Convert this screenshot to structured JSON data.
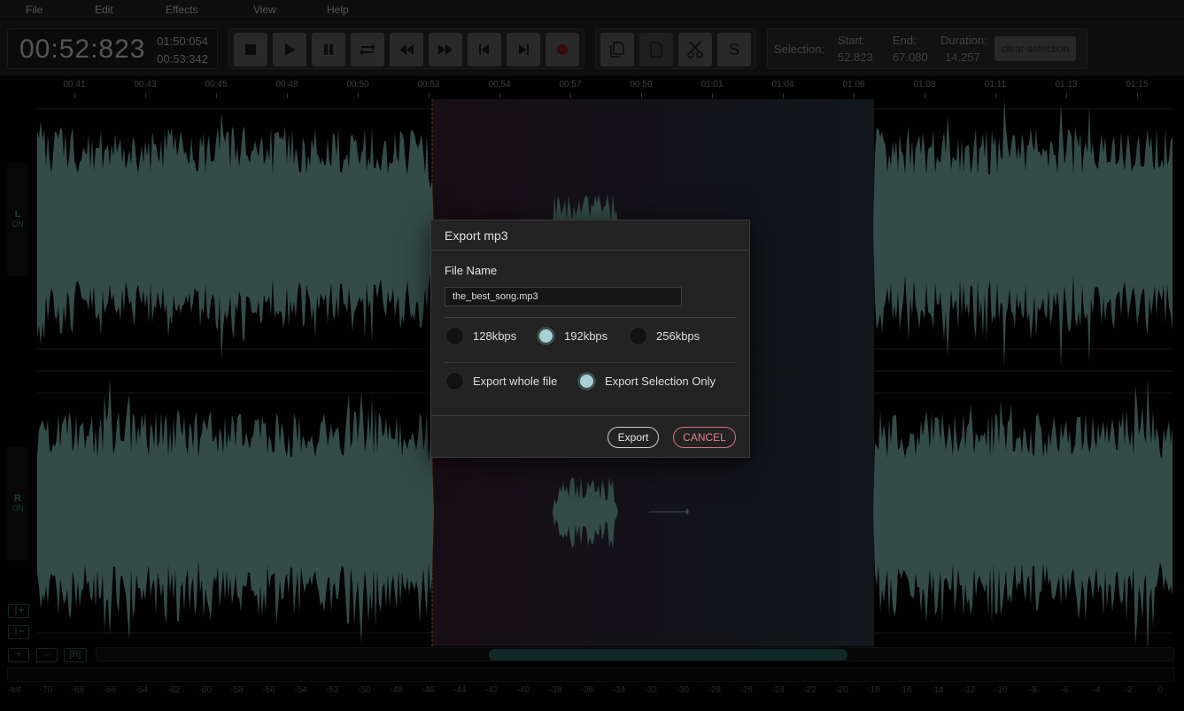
{
  "menu": [
    {
      "label": "File"
    },
    {
      "label": "Edit"
    },
    {
      "label": "Effects"
    },
    {
      "label": "View"
    },
    {
      "label": "Help"
    }
  ],
  "time": {
    "current": "00:52:823",
    "total": "01:50:054",
    "position": "00:53:342"
  },
  "transport": [
    "stop-icon",
    "play-icon",
    "pause-icon",
    "loop-icon",
    "rewind-icon",
    "fast-forward-icon",
    "skip-back-icon",
    "skip-forward-icon",
    "record-icon"
  ],
  "edit_tools": [
    "copy-icon",
    "paste-icon",
    "cut-icon",
    "silence-icon"
  ],
  "silence_label": "S",
  "selection": {
    "label": "Selection:",
    "start_label": "Start:",
    "start": "52.823",
    "end_label": "End:",
    "end": "67.080",
    "duration_label": "Duration:",
    "duration": "14.257",
    "clear_label": "clear selection"
  },
  "ruler_ticks": [
    "00:41",
    "00:43",
    "00:45",
    "00:48",
    "00:50",
    "00:52",
    "00:54",
    "00:57",
    "00:59",
    "01:01",
    "01:04",
    "01:06",
    "01:08",
    "01:11",
    "01:13",
    "01:15"
  ],
  "channels": [
    {
      "letter": "L",
      "state": "ON"
    },
    {
      "letter": "R",
      "state": "ON"
    }
  ],
  "zoom_buttons": {
    "zoom_in": "+",
    "zoom_out": "–",
    "reset": "[R]"
  },
  "meter_scale": [
    "-Inf",
    "-70",
    "-68",
    "-66",
    "-64",
    "-62",
    "-60",
    "-58",
    "-56",
    "-54",
    "-52",
    "-50",
    "-48",
    "-46",
    "-44",
    "-42",
    "-40",
    "-38",
    "-36",
    "-34",
    "-32",
    "-30",
    "-28",
    "-26",
    "-24",
    "-22",
    "-20",
    "-18",
    "-16",
    "-14",
    "-12",
    "-10",
    "-8",
    "-6",
    "-4",
    "-2",
    "0"
  ],
  "dialog": {
    "title": "Export mp3",
    "file_name_label": "File Name",
    "file_name_value": "the_best_song.mp3",
    "bitrates": [
      {
        "label": "128kbps",
        "checked": false
      },
      {
        "label": "192kbps",
        "checked": true
      },
      {
        "label": "256kbps",
        "checked": false
      }
    ],
    "scope": [
      {
        "label": "Export whole file",
        "checked": false
      },
      {
        "label": "Export Selection Only",
        "checked": true
      }
    ],
    "export_label": "Export",
    "cancel_label": "CANCEL"
  },
  "colors": {
    "waveform": "#5d8b84",
    "selection_tint": "#1f2b34",
    "accent_checked": "#a8cfd4",
    "cancel": "#e08288"
  }
}
